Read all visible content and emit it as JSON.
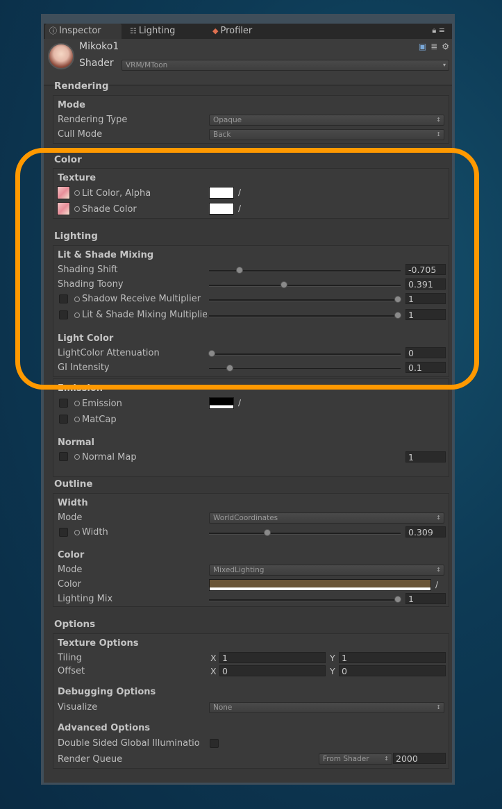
{
  "tabs": [
    {
      "label": "Inspector",
      "icon": "info-icon"
    },
    {
      "label": "Lighting",
      "icon": "sliders-icon"
    },
    {
      "label": "Profiler",
      "icon": "profiler-icon"
    }
  ],
  "object": {
    "name": "Mikoko1",
    "shader_label": "Shader",
    "shader_value": "VRM/MToon"
  },
  "rendering": {
    "title": "Rendering",
    "mode_title": "Mode",
    "rendering_type_label": "Rendering Type",
    "rendering_type_value": "Opaque",
    "cull_mode_label": "Cull Mode",
    "cull_mode_value": "Back"
  },
  "color": {
    "title": "Color",
    "texture_title": "Texture",
    "lit_color_label": "Lit Color, Alpha",
    "shade_color_label": "Shade Color"
  },
  "lighting": {
    "title": "Lighting",
    "mixing_title": "Lit & Shade Mixing",
    "shading_shift_label": "Shading Shift",
    "shading_shift_value": "-0.705",
    "shading_toony_label": "Shading Toony",
    "shading_toony_value": "0.391",
    "shadow_receive_label": "Shadow Receive Multiplier",
    "shadow_receive_value": "1",
    "lit_shade_mult_label": "Lit & Shade Mixing Multiplie",
    "lit_shade_mult_value": "1",
    "light_color_title": "Light Color",
    "attenuation_label": "LightColor Attenuation",
    "attenuation_value": "0",
    "gi_label": "GI Intensity",
    "gi_value": "0.1"
  },
  "emission": {
    "title": "Emission",
    "emission_label": "Emission",
    "matcap_label": "MatCap"
  },
  "normal": {
    "title": "Normal",
    "normal_map_label": "Normal Map",
    "normal_map_value": "1"
  },
  "outline": {
    "title": "Outline",
    "width_title": "Width",
    "width_mode_label": "Mode",
    "width_mode_value": "WorldCoordinates",
    "width_label": "Width",
    "width_value": "0.309",
    "color_title": "Color",
    "color_mode_label": "Mode",
    "color_mode_value": "MixedLighting",
    "color_label": "Color",
    "lighting_mix_label": "Lighting Mix",
    "lighting_mix_value": "1"
  },
  "options": {
    "title": "Options",
    "texture_options_title": "Texture Options",
    "tiling_label": "Tiling",
    "tiling_x": "1",
    "tiling_y": "1",
    "offset_label": "Offset",
    "offset_x": "0",
    "offset_y": "0",
    "x_label": "X",
    "y_label": "Y",
    "debugging_title": "Debugging Options",
    "visualize_label": "Visualize",
    "visualize_value": "None",
    "advanced_title": "Advanced Options",
    "double_sided_label": "Double Sided Global Illuminatio",
    "render_queue_label": "Render Queue",
    "render_queue_mode": "From Shader",
    "render_queue_value": "2000"
  },
  "colors": {
    "highlight": "#ff9900",
    "outline_color": "#6b5638"
  }
}
